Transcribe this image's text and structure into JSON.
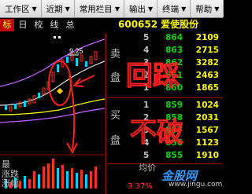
{
  "menubar": {
    "items": [
      {
        "label": "工作区",
        "icon": "chevron-down-icon"
      },
      {
        "label": "近期",
        "icon": "chevron-down-icon"
      },
      {
        "label": "常用栏目",
        "icon": "chevron-down-icon"
      },
      {
        "label": "输出",
        "icon": "chevron-down-icon"
      },
      {
        "label": "终端",
        "icon": "chevron-down-icon"
      },
      {
        "label": "帮助",
        "icon": "chevron-down-icon"
      }
    ]
  },
  "toolbar": {
    "items": [
      "标",
      "日",
      "校",
      "线",
      "总"
    ]
  },
  "quote": {
    "code": "600652",
    "name": "爱使股份"
  },
  "chart": {
    "price_label": "9.25"
  },
  "orderbook": {
    "sell_label": "卖",
    "sell_label2": "盘",
    "buy_label": "买",
    "buy_label2": "盘",
    "sell": [
      {
        "level": "5",
        "price": "864",
        "volume": "2109"
      },
      {
        "level": "4",
        "price": "863",
        "volume": "2715"
      },
      {
        "level": "3",
        "price": "862",
        "volume": "3282"
      },
      {
        "level": "2",
        "price": "861",
        "volume": "2463"
      },
      {
        "level": "1",
        "price": "860",
        "volume": "1865"
      }
    ],
    "buy": [
      {
        "level": "1",
        "price": "859",
        "volume": "1024"
      },
      {
        "level": "2",
        "price": "858",
        "volume": "2031"
      },
      {
        "level": "3",
        "price": "857",
        "volume": "1567"
      },
      {
        "level": "4",
        "price": "856",
        "volume": "1123"
      },
      {
        "level": "5",
        "price": "855",
        "volume": "1910"
      }
    ]
  },
  "footer": {
    "left_line1": "最",
    "left_line2": "涨跌",
    "left_line3": "涨幅",
    "right": "均价",
    "value": "3.37%"
  },
  "annotations": {
    "handwriting1": "回踩",
    "handwriting2": "不破"
  },
  "watermark": {
    "text": "金股网",
    "sub": "www.jingu.com"
  }
}
